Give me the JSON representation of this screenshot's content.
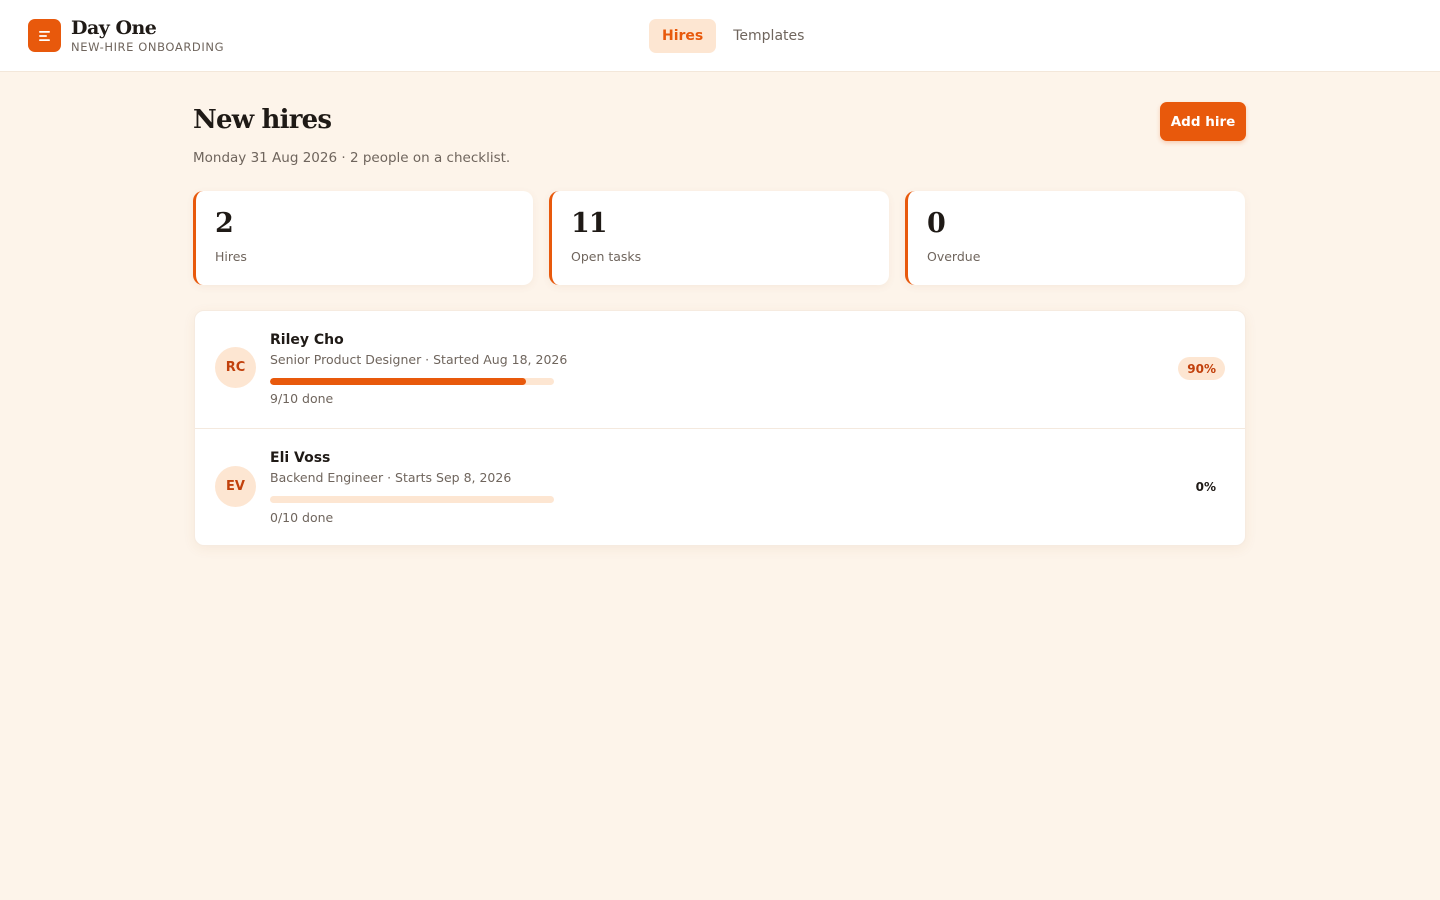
{
  "app": {
    "title": "Day One",
    "subtitle": "NEW-HIRE ONBOARDING",
    "logo_icon": "menu-lines-icon"
  },
  "nav": {
    "tabs": [
      {
        "label": "Hires",
        "active": true
      },
      {
        "label": "Templates",
        "active": false
      }
    ]
  },
  "page": {
    "title": "New hires",
    "subtitle": "Monday 31 Aug 2026 · 2 people on a checklist.",
    "add_button": "Add hire"
  },
  "stats": [
    {
      "value": "2",
      "label": "Hires"
    },
    {
      "value": "11",
      "label": "Open tasks"
    },
    {
      "value": "0",
      "label": "Overdue"
    }
  ],
  "hires": [
    {
      "initials": "RC",
      "name": "Riley Cho",
      "meta": "Senior Product Designer · Started Aug 18, 2026",
      "progress": 0.9,
      "done": "9/10 done",
      "percent": "90%"
    },
    {
      "initials": "EV",
      "name": "Eli Voss",
      "meta": "Backend Engineer · Starts Sep 8, 2026",
      "progress": 0,
      "done": "0/10 done",
      "percent": "0%"
    }
  ],
  "colors": {
    "accent": "#e8590c",
    "accent_soft": "#fde6d2",
    "background": "#fdf4ea"
  }
}
